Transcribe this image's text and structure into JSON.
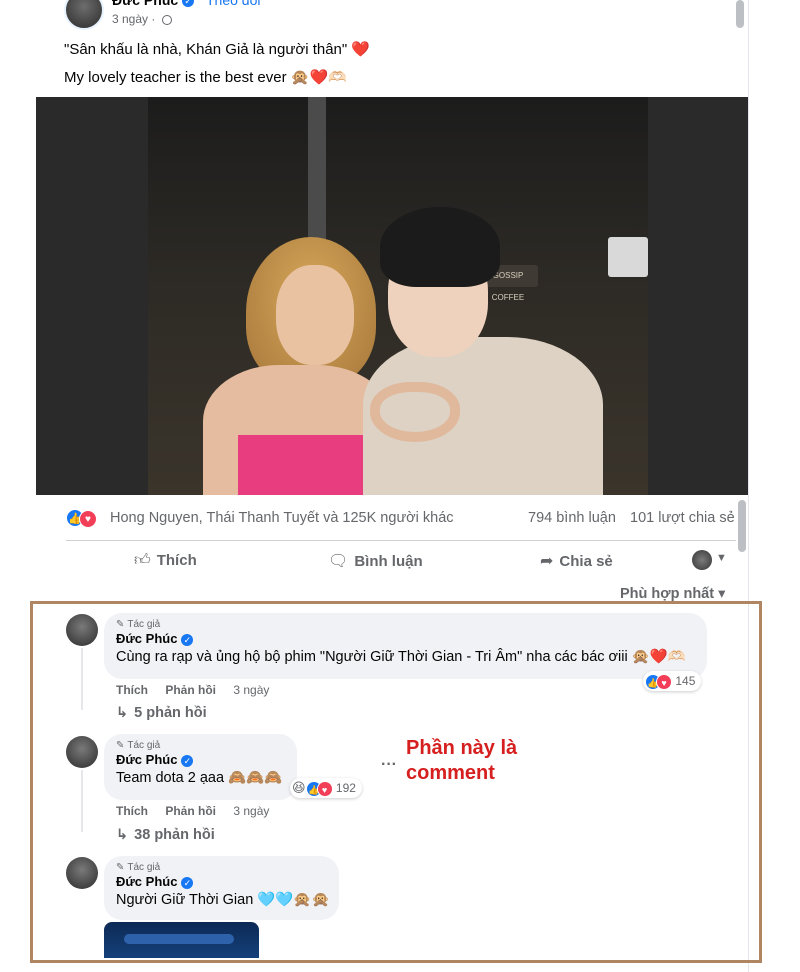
{
  "post": {
    "author": "Đức Phúc",
    "follow": "Theo dõi",
    "time": "3 ngày",
    "caption_1": "\"Sân khấu là nhà, Khán Giả là người thân\" ❤️",
    "caption_2": "My lovely teacher is the best ever 🙊❤️🫶🏻"
  },
  "stats": {
    "reactors": "Hong Nguyen, Thái Thanh Tuyết và 125K người khác",
    "comments": "794 bình luận",
    "shares": "101 lượt chia sẻ"
  },
  "actions": {
    "like": "Thích",
    "comment": "Bình luận",
    "share": "Chia sẻ"
  },
  "sort": {
    "label": "Phù hợp nhất ▾"
  },
  "photo_sign": "GOSSIP COFFEE",
  "comments": [
    {
      "author_tag": "Tác giả",
      "author": "Đức Phúc",
      "text": "Cùng ra rạp và ủng hộ bộ phim \"Người Giữ Thời Gian - Tri Âm\" nha các bác ơiii 🙊❤️🫶🏻",
      "like": "Thích",
      "reply": "Phản hồi",
      "time": "3 ngày",
      "reaction_count": "145",
      "replies": "5 phản hồi"
    },
    {
      "author_tag": "Tác giả",
      "author": "Đức Phúc",
      "text": "Team dota 2 ạaa 🙈🙈🙈",
      "like": "Thích",
      "reply": "Phản hồi",
      "time": "3 ngày",
      "reaction_count": "192",
      "replies": "38 phản hồi"
    },
    {
      "author_tag": "Tác giả",
      "author": "Đức Phúc",
      "text": "Người Giữ Thời Gian 🩵🩵🙊🙊"
    }
  ],
  "annotation": {
    "line1": "Phần này là",
    "line2": "comment"
  },
  "colors": {
    "accent": "#1877f2",
    "annotation": "#d61f1f",
    "highlight_border": "#b08662"
  }
}
